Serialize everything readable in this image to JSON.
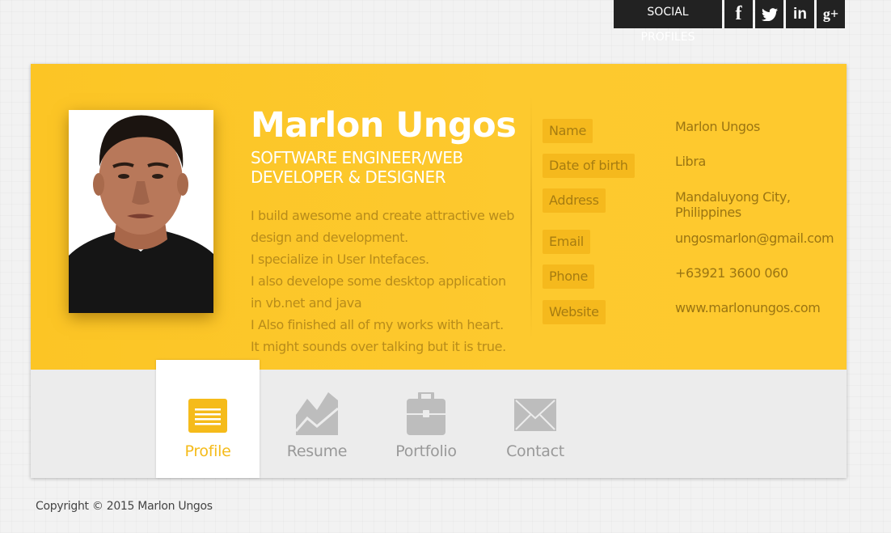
{
  "social": {
    "label": "SOCIAL PROFILES",
    "items": [
      {
        "icon": "facebook-icon",
        "glyph": "f"
      },
      {
        "icon": "twitter-icon",
        "glyph": ""
      },
      {
        "icon": "linkedin-icon",
        "glyph": "in"
      },
      {
        "icon": "google-plus-icon",
        "glyph": "g+"
      }
    ]
  },
  "profile": {
    "name": "Marlon Ungos",
    "role": "SOFTWARE ENGINEER/WEB DEVELOPER & DESIGNER",
    "bio": [
      "I build awesome and create attractive web",
      "design and development.",
      "I specialize in User Intefaces.",
      "I also develope some desktop application",
      "in vb.net and java",
      "I Also finished all of my works with heart.",
      "It might sounds over talking but it is true."
    ]
  },
  "info": [
    {
      "label": "Name",
      "value": "Marlon Ungos"
    },
    {
      "label": "Date of birth",
      "value": "Libra"
    },
    {
      "label": "Address",
      "value": "Mandaluyong City, Philippines"
    },
    {
      "label": "Email",
      "value": "ungosmarlon@gmail.com"
    },
    {
      "label": "Phone",
      "value": "+63921 3600 060"
    },
    {
      "label": "Website",
      "value": "www.marlonungos.com"
    }
  ],
  "tabs": [
    {
      "label": "Profile",
      "icon": "profile-icon",
      "active": true
    },
    {
      "label": "Resume",
      "icon": "resume-chart-icon",
      "active": false
    },
    {
      "label": "Portfolio",
      "icon": "briefcase-icon",
      "active": false
    },
    {
      "label": "Contact",
      "icon": "envelope-icon",
      "active": false
    }
  ],
  "footer": {
    "copyright": "Copyright © 2015 Marlon Ungos"
  },
  "colors": {
    "accent": "#fdc82a",
    "dark": "#222222",
    "tab_active": "#f5bb1a",
    "tab_inactive": "#999999"
  }
}
